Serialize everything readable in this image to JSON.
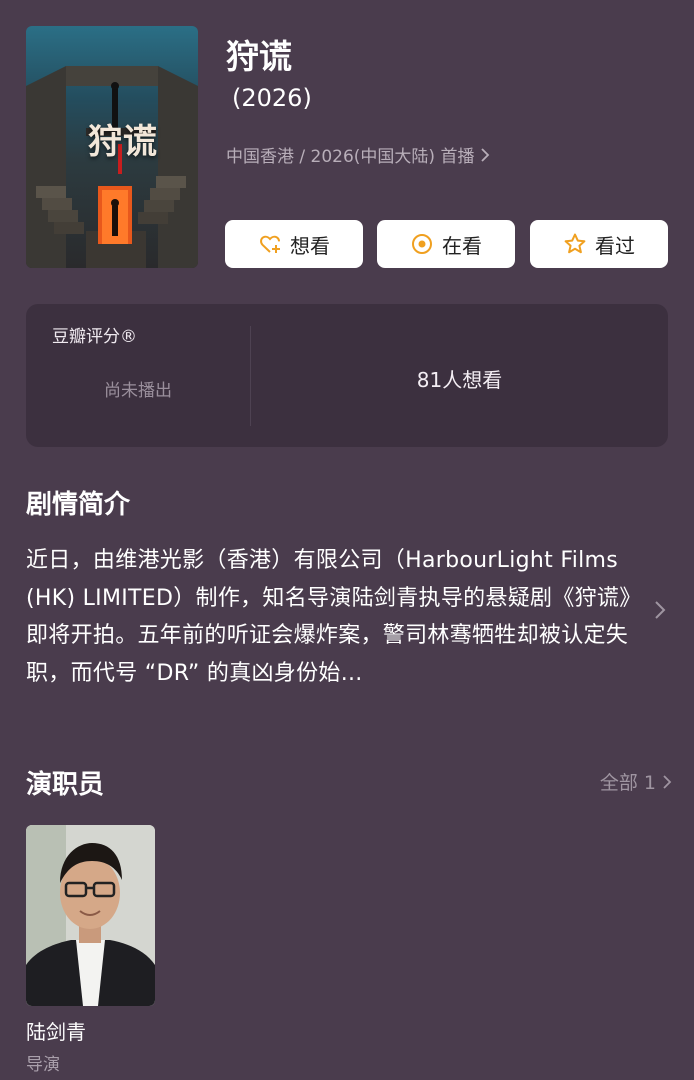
{
  "header": {
    "title": "狩谎",
    "year": "(2026)",
    "meta": "中国香港 / 2026(中国大陆) 首播",
    "poster_title": "狩谎"
  },
  "actions": {
    "want_label": "想看",
    "watching_label": "在看",
    "watched_label": "看过"
  },
  "rating": {
    "label": "豆瓣评分®",
    "status": "尚未播出",
    "want_count": "81人想看"
  },
  "synopsis": {
    "heading": "剧情简介",
    "text": "近日，由维港光影（香港）有限公司（HarbourLight Films (HK) LIMITED）制作，知名导演陆剑青执导的悬疑剧《狩谎》即将开拍。五年前的听证会爆炸案，警司林骞牺牲却被认定失职，而代号 “DR” 的真凶身份始..."
  },
  "cast": {
    "heading": "演职员",
    "all_label": "全部 1",
    "members": [
      {
        "name": "陆剑青",
        "role": "导演"
      }
    ]
  },
  "colors": {
    "background": "#4a3c4d",
    "card": "#3c303f",
    "accent_orange": "#f0a020",
    "muted_text": "#b8aeb9"
  }
}
